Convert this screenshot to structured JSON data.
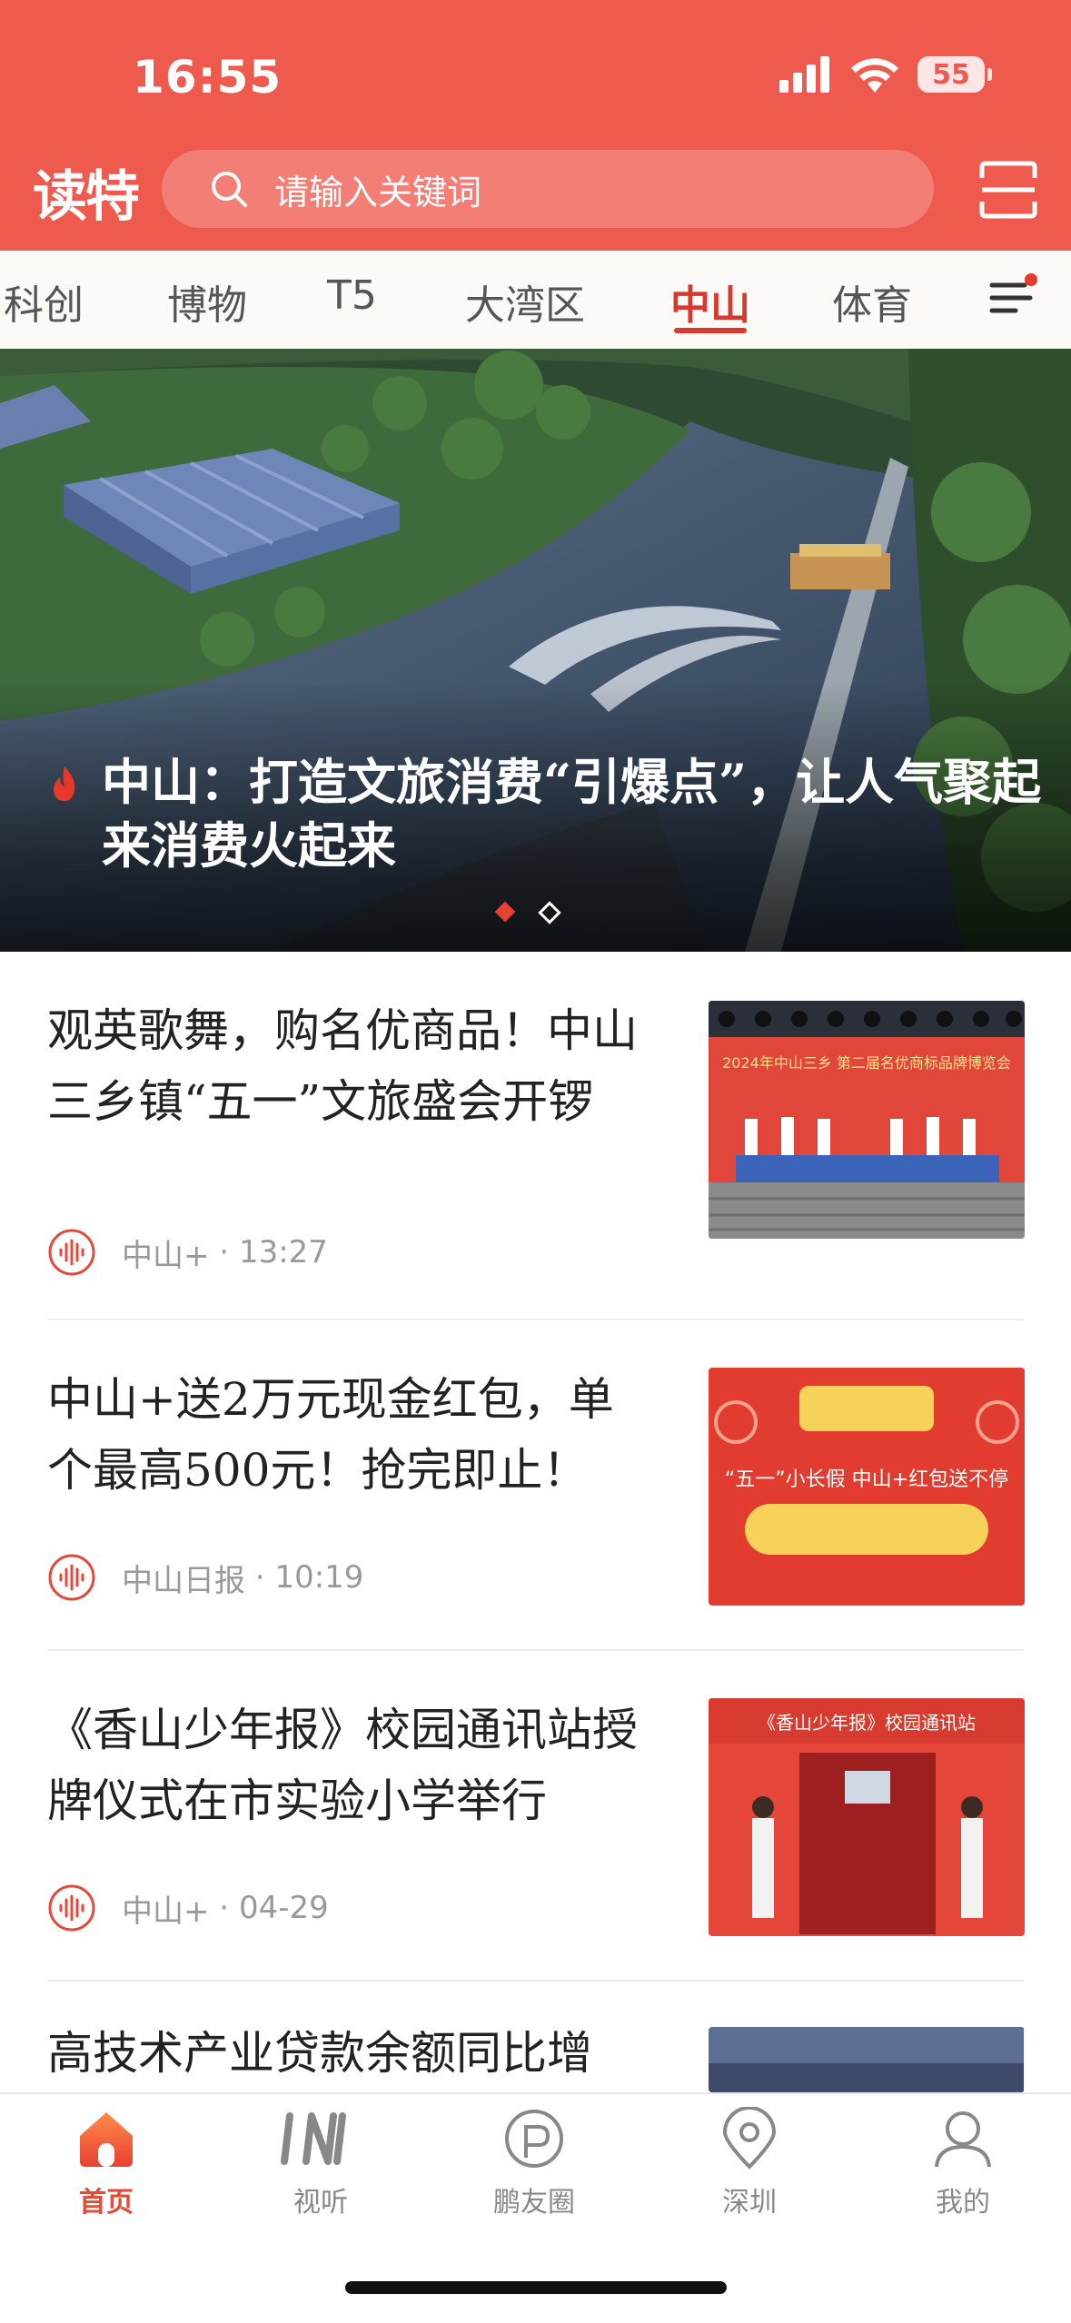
{
  "status": {
    "time": "16:55",
    "battery": "55"
  },
  "header": {
    "logo": "读特",
    "search_placeholder": "请输入关键词"
  },
  "tabs": [
    {
      "label": "科创"
    },
    {
      "label": "博物"
    },
    {
      "label": "T5"
    },
    {
      "label": "大湾区"
    },
    {
      "label": "中山",
      "active": true
    },
    {
      "label": "体育"
    }
  ],
  "hero": {
    "title": "中山：打造文旅消费“引爆点”，让人气聚起来消费火起来",
    "page_count": 2,
    "current_page": 1
  },
  "articles": [
    {
      "title": "观英歌舞，购名优商品！中山三乡镇“五一”文旅盛会开锣",
      "source": "中山+",
      "time": "13:27",
      "thumb_caption": "2024年中山三乡 第二届名优商标品牌博览会"
    },
    {
      "title": "中山+送2万元现金红包，单个最高500元！抢完即止！",
      "source": "中山日报",
      "time": "10:19",
      "thumb_caption": "“五一”小长假 中山+红包送不停"
    },
    {
      "title": "《香山少年报》校园通讯站授牌仪式在市实验小学举行",
      "source": "中山+",
      "time": "04-29",
      "thumb_caption": "《香山少年报》校园通讯站"
    },
    {
      "title": "高技术产业贷款余额同比增",
      "source": "",
      "time": ""
    }
  ],
  "bottom_nav": [
    {
      "label": "首页",
      "icon": "home-icon",
      "active": true
    },
    {
      "label": "视听",
      "icon": "in-icon"
    },
    {
      "label": "鹏友圈",
      "icon": "circle-p-icon"
    },
    {
      "label": "深圳",
      "icon": "location-pin-icon"
    },
    {
      "label": "我的",
      "icon": "person-icon"
    }
  ],
  "colors": {
    "brand": "#ef5a4f",
    "accent": "#d9382f",
    "muted": "#999999"
  }
}
